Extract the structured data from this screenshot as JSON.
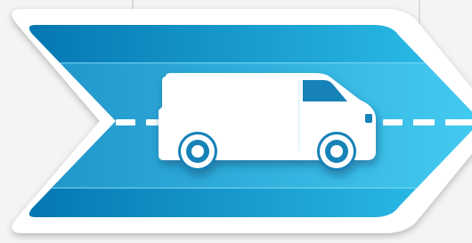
{
  "graphic": {
    "shape": "chevron-arrow-right",
    "icon": "delivery-van-icon",
    "colors": {
      "background": "#f4f4f4",
      "frame": "#ffffff",
      "arrow_dark": "#0577b1",
      "arrow_light": "#2ec2ec",
      "road_band_dark": "#1d90c5",
      "road_band_light": "#45cdf3",
      "road_marking": "#ffffff",
      "van": "#ffffff",
      "van_detail": "#1682b8",
      "wheel_hub": "#ffffff",
      "shadow": "#0a4d72"
    }
  }
}
